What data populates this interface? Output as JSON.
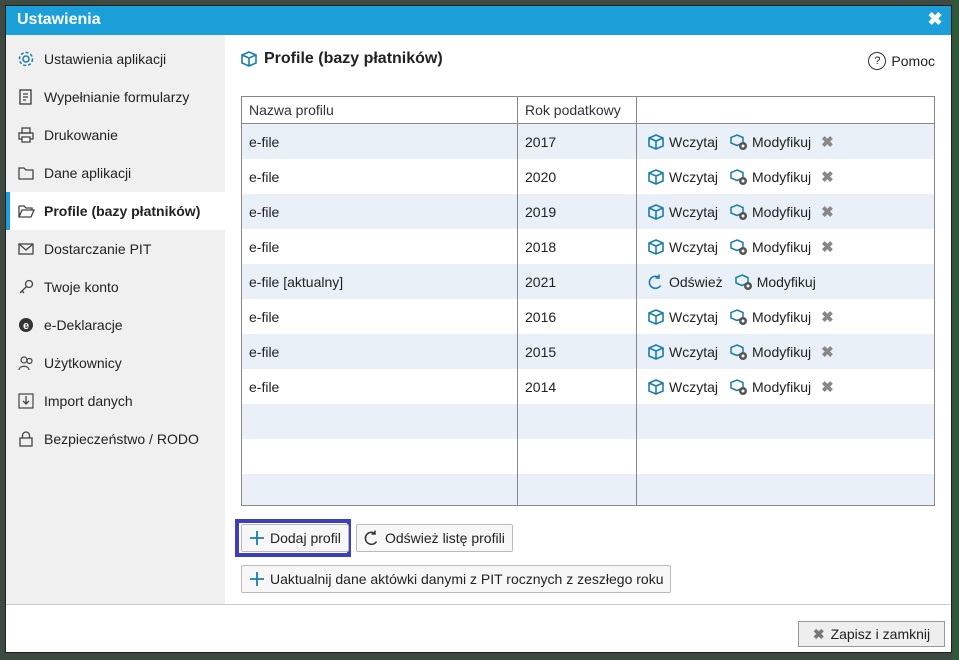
{
  "window": {
    "title": "Ustawienia"
  },
  "sidebar": {
    "items": [
      {
        "label": "Ustawienia aplikacji",
        "icon": "gear-icon"
      },
      {
        "label": "Wypełnianie formularzy",
        "icon": "form-icon"
      },
      {
        "label": "Drukowanie",
        "icon": "printer-icon"
      },
      {
        "label": "Dane aplikacji",
        "icon": "folder-icon"
      },
      {
        "label": "Profile (bazy płatników)",
        "icon": "folder-open-icon",
        "active": true
      },
      {
        "label": "Dostarczanie PIT",
        "icon": "envelope-icon"
      },
      {
        "label": "Twoje konto",
        "icon": "key-icon"
      },
      {
        "label": "e-Deklaracje",
        "icon": "e-icon"
      },
      {
        "label": "Użytkownicy",
        "icon": "users-icon"
      },
      {
        "label": "Import danych",
        "icon": "import-icon"
      },
      {
        "label": "Bezpieczeństwo / RODO",
        "icon": "lock-icon"
      }
    ]
  },
  "main": {
    "title": "Profile (bazy płatników)",
    "help_label": "Pomoc",
    "table": {
      "columns": [
        "Nazwa profilu",
        "Rok podatkowy",
        ""
      ],
      "rows": [
        {
          "name": "e-file",
          "year": "2017",
          "current": false
        },
        {
          "name": "e-file",
          "year": "2020",
          "current": false
        },
        {
          "name": "e-file",
          "year": "2019",
          "current": false
        },
        {
          "name": "e-file",
          "year": "2018",
          "current": false
        },
        {
          "name": "e-file [aktualny]",
          "year": "2021",
          "current": true
        },
        {
          "name": "e-file",
          "year": "2016",
          "current": false
        },
        {
          "name": "e-file",
          "year": "2015",
          "current": false
        },
        {
          "name": "e-file",
          "year": "2014",
          "current": false
        }
      ],
      "empty_rows": 3
    },
    "actions": {
      "load": "Wczytaj",
      "modify": "Modyfikuj",
      "refresh": "Odśwież"
    },
    "buttons": {
      "add_profile": "Dodaj profil",
      "refresh_list": "Odśwież listę profili",
      "update_data": "Uaktualnij dane aktówki danymi z PIT rocznych z zeszłego roku"
    }
  },
  "footer": {
    "save_close": "Zapisz i zamknij"
  },
  "colors": {
    "accent": "#1a9fd8",
    "focus": "#3b3fc0",
    "row_alt": "#e9f0f7"
  }
}
